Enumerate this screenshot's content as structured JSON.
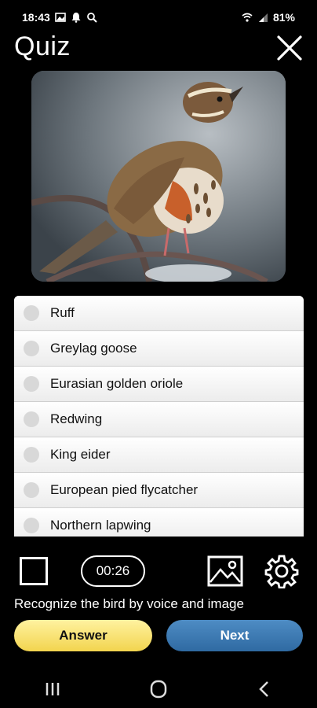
{
  "status_bar": {
    "time": "18:43",
    "battery": "81%"
  },
  "header": {
    "title": "Quiz"
  },
  "photo": {
    "subject": "redwing bird on branch"
  },
  "answers": [
    "Ruff",
    "Greylag goose",
    "Eurasian golden oriole",
    "Redwing",
    "King eider",
    "European pied flycatcher",
    "Northern lapwing"
  ],
  "toolbar": {
    "timer": "00:26"
  },
  "hint": "Recognize the bird by voice and image",
  "buttons": {
    "answer": "Answer",
    "next": "Next"
  }
}
